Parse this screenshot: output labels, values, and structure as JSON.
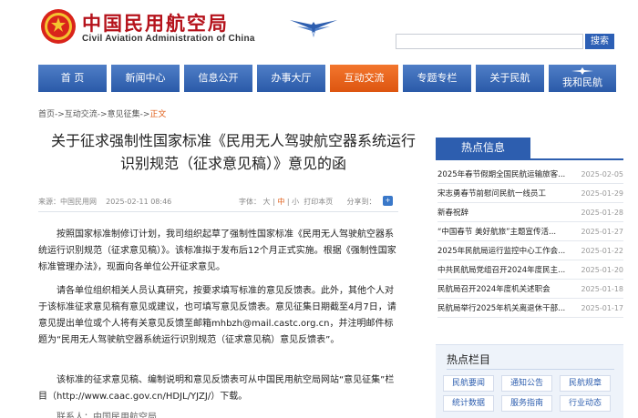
{
  "header": {
    "title_cn": "中国民用航空局",
    "title_en": "Civil Aviation Administration of China",
    "search_placeholder": "",
    "search_button": "搜索"
  },
  "nav": [
    {
      "label": "首 页",
      "active": false
    },
    {
      "label": "新闻中心",
      "active": false
    },
    {
      "label": "信息公开",
      "active": false
    },
    {
      "label": "办事大厅",
      "active": false
    },
    {
      "label": "互动交流",
      "active": true
    },
    {
      "label": "专题专栏",
      "active": false
    },
    {
      "label": "关于民航",
      "active": false
    },
    {
      "label": "我和民航",
      "active": false
    }
  ],
  "breadcrumb": {
    "path": "首页->互动交流->意见征集->",
    "current": "正文"
  },
  "article": {
    "title_line1": "关于征求强制性国家标准《民用无人驾驶航空器系统运行",
    "title_line2": "识别规范（征求意见稿）》意见的函",
    "source": "来源：中国民用网",
    "date": "2025-02-11 08:46",
    "font_label": "字体：",
    "font_large": "大",
    "font_medium": "中",
    "font_small": "小",
    "print": "打印本页",
    "share": "分享到：",
    "p1": "按照国家标准制修订计划，我司组织起草了强制性国家标准《民用无人驾驶航空器系统运行识别规范（征求意见稿）》。该标准拟于发布后12个月正式实施。根据《强制性国家标准管理办法》，现面向各单位公开征求意见。",
    "p2": "请各单位组织相关人员认真研究，按要求填写标准的意见反馈表。此外，其他个人对于该标准征求意见稿有意见或建议，也可填写意见反馈表。意见征集日期截至4月7日，请意见提出单位或个人将有关意见反馈至邮箱mhbzh@mail.castc.org.cn，并注明邮件标题为“民用无人驾驶航空器系统运行识别规范（征求意见稿）意见反馈表”。",
    "p3": "该标准的征求意见稿、编制说明和意见反馈表可从中国民用航空局网站“意见征集”栏目（http://www.caac.gov.cn/HDJL/YJZJ/）下载。",
    "p4": "联系人：中国民用航空局"
  },
  "hot_news": {
    "title": "热点信息",
    "items": [
      {
        "title": "2025年春节假期全国民航运输旅客...",
        "date": "2025-02-05"
      },
      {
        "title": "宋志勇春节前慰问民航一线员工",
        "date": "2025-01-29"
      },
      {
        "title": "新春祝辞",
        "date": "2025-01-28"
      },
      {
        "title": "“中国春节 美好航旅”主题宣传活...",
        "date": "2025-01-27"
      },
      {
        "title": "2025年民航局运行监控中心工作会...",
        "date": "2025-01-22"
      },
      {
        "title": "中共民航局党组召开2024年度民主...",
        "date": "2025-01-20"
      },
      {
        "title": "民航局召开2024年度机关述职会",
        "date": "2025-01-18"
      },
      {
        "title": "民航局举行2025年机关离退休干部...",
        "date": "2025-01-17"
      }
    ]
  },
  "hot_columns": {
    "title": "热点栏目",
    "tags": [
      "民航要闻",
      "通知公告",
      "民航规章",
      "统计数据",
      "服务指南",
      "行业动态"
    ]
  },
  "colors": {
    "brand_red": "#b5121b",
    "nav_blue": "#2a5aa8",
    "nav_active": "#e05d17"
  }
}
